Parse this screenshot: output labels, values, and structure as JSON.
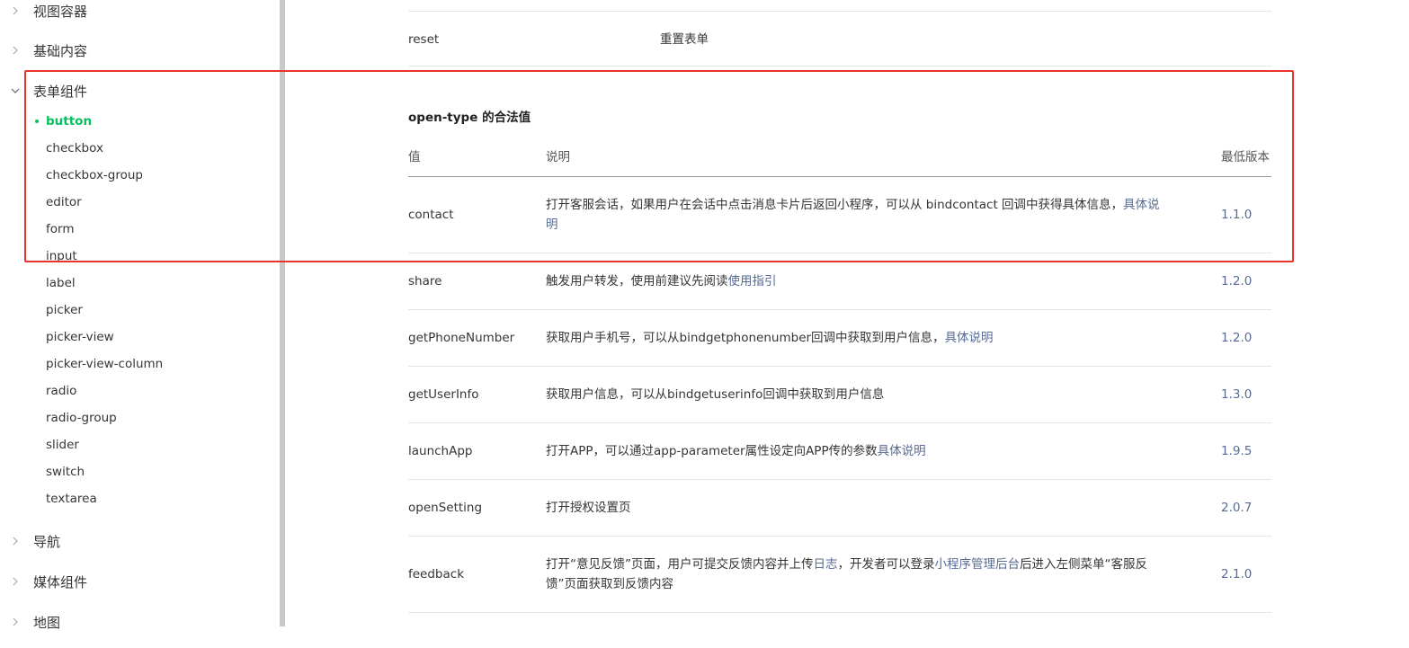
{
  "sidebar": {
    "groups": [
      {
        "label": "视图容器",
        "expanded": false
      },
      {
        "label": "基础内容",
        "expanded": false
      },
      {
        "label": "表单组件",
        "expanded": true
      },
      {
        "label": "导航",
        "expanded": false
      },
      {
        "label": "媒体组件",
        "expanded": false
      },
      {
        "label": "地图",
        "expanded": false
      }
    ],
    "items": [
      "button",
      "checkbox",
      "checkbox-group",
      "editor",
      "form",
      "input",
      "label",
      "picker",
      "picker-view",
      "picker-view-column",
      "radio",
      "radio-group",
      "slider",
      "switch",
      "textarea"
    ],
    "active_item": "button"
  },
  "prev_table": {
    "row": {
      "value": "reset",
      "desc": "重置表单"
    }
  },
  "open_type": {
    "title": "open-type 的合法值",
    "headers": {
      "value": "值",
      "desc": "说明",
      "version": "最低版本"
    },
    "rows": [
      {
        "value": "contact",
        "desc": "打开客服会话，如果用户在会话中点击消息卡片后返回小程序，可以从 bindcontact 回调中获得具体信息，",
        "desc_link": "具体说",
        "desc2_link": "明",
        "version": "1.1.0"
      },
      {
        "value": "share",
        "desc": "触发用户转发，使用前建议先阅读",
        "desc_link": "使用指引",
        "version": "1.2.0"
      },
      {
        "value": "getPhoneNumber",
        "desc": "获取用户手机号，可以从bindgetphonenumber回调中获取到用户信息，",
        "desc_link": "具体说明",
        "version": "1.2.0"
      },
      {
        "value": "getUserInfo",
        "desc": "获取用户信息，可以从bindgetuserinfo回调中获取到用户信息",
        "version": "1.3.0"
      },
      {
        "value": "launchApp",
        "desc": "打开APP，可以通过app-parameter属性设定向APP传的参数",
        "desc_link": "具体说明",
        "version": "1.9.5"
      },
      {
        "value": "openSetting",
        "desc": "打开授权设置页",
        "version": "2.0.7"
      },
      {
        "value": "feedback",
        "desc_a": "打开“意见反馈”页面，用户可提交反馈内容并上传",
        "link_a": "日志",
        "desc_b": "，开发者可以登录",
        "link_b": "小程序管理后台",
        "desc_c": "后进入左侧菜单“客服反",
        "desc_d": "馈”页面获取到反馈内容",
        "version": "2.1.0"
      }
    ]
  },
  "colors": {
    "accent": "#07c160",
    "link": "#576b95",
    "highlight": "#e8342b"
  }
}
